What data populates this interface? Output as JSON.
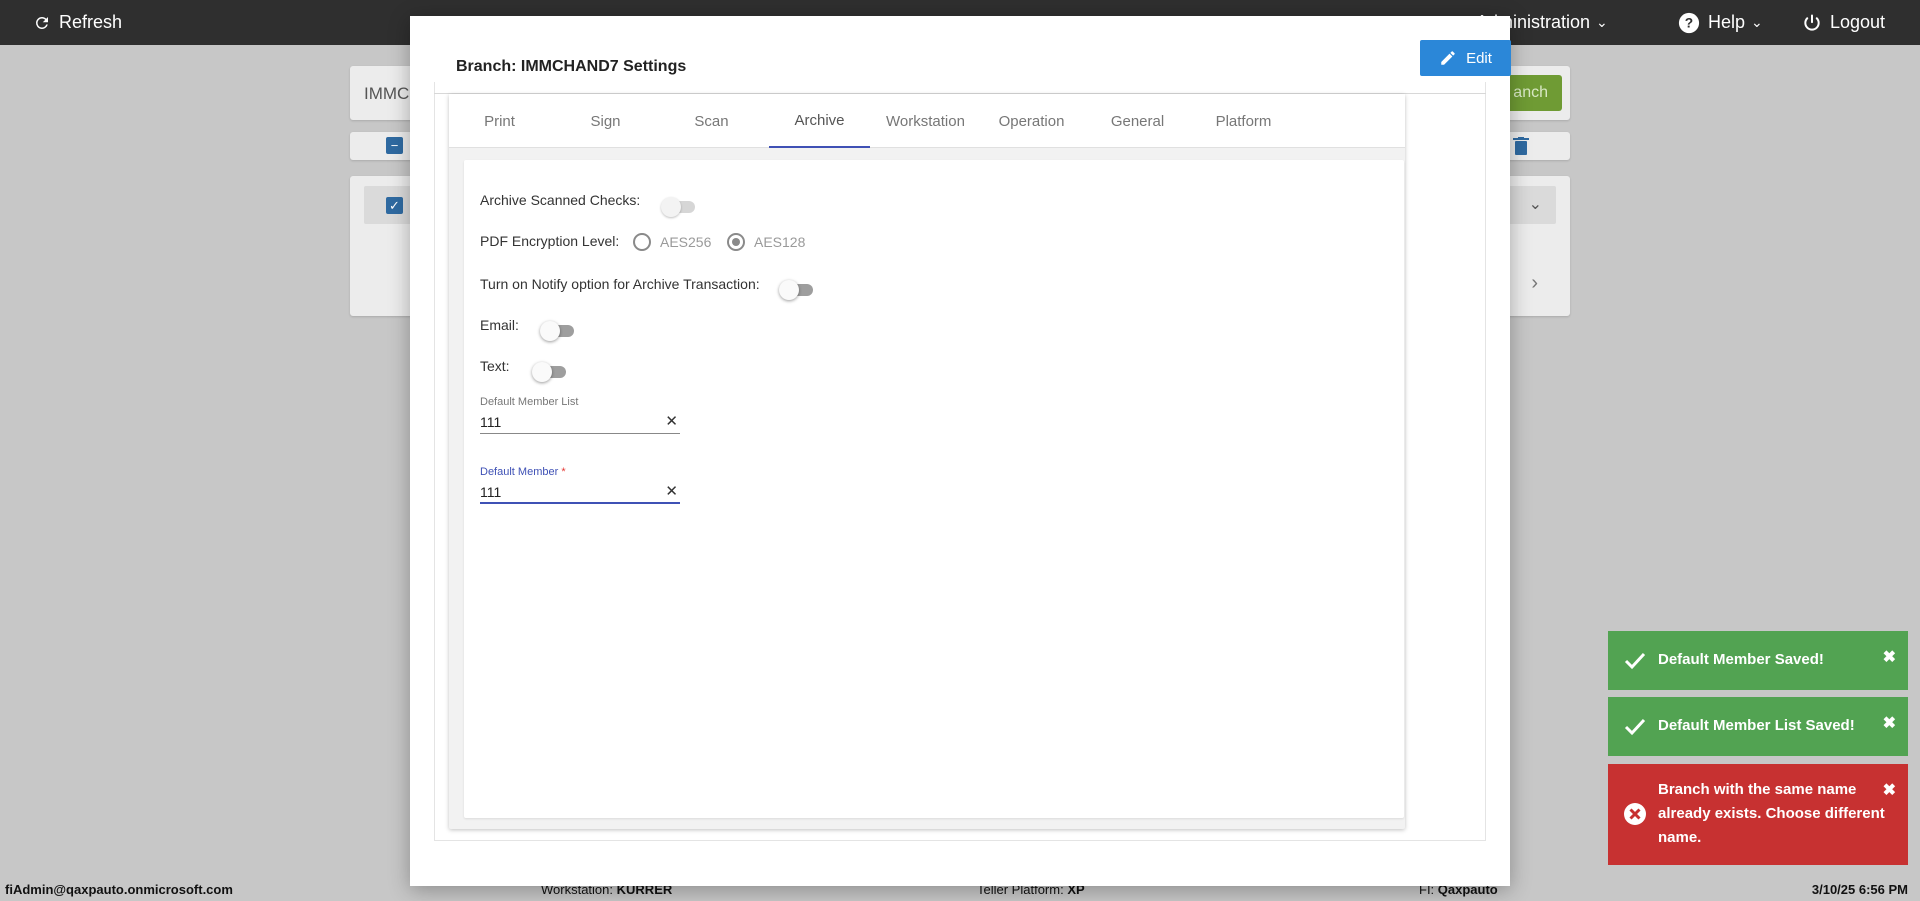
{
  "topbar": {
    "refresh_label": "Refresh",
    "administration_label": "Administration",
    "help_label": "Help",
    "logout_label": "Logout"
  },
  "background": {
    "search_value": "IMMCH",
    "add_button_label": "anch"
  },
  "modal": {
    "title": "Branch: IMMCHAND7 Settings",
    "edit_label": "Edit",
    "tabs": [
      {
        "label": "Print"
      },
      {
        "label": "Sign"
      },
      {
        "label": "Scan"
      },
      {
        "label": "Archive",
        "active": true
      },
      {
        "label": "Workstation"
      },
      {
        "label": "Operation"
      },
      {
        "label": "General"
      },
      {
        "label": "Platform"
      }
    ],
    "archive": {
      "archive_scanned_checks_label": "Archive Scanned Checks:",
      "pdf_encryption_label": "PDF Encryption Level:",
      "encryption_options": [
        "AES256",
        "AES128"
      ],
      "encryption_selected": "AES128",
      "notify_label": "Turn on Notify option for Archive Transaction:",
      "email_label": "Email:",
      "text_label": "Text:",
      "default_member_list_label": "Default Member List",
      "default_member_list_value": "111",
      "default_member_label": "Default Member",
      "default_member_required": "*",
      "default_member_value": "111"
    }
  },
  "toasts": [
    {
      "type": "success",
      "message": "Default Member Saved!"
    },
    {
      "type": "success",
      "message": "Default Member List Saved!"
    },
    {
      "type": "error",
      "message": "Branch with the same name already exists. Choose different name."
    }
  ],
  "statusbar": {
    "user": "fiAdmin@qaxpauto.onmicrosoft.com",
    "workstation_label": "Workstation:",
    "workstation_value": "KURRER",
    "teller_platform_label": "Teller Platform:",
    "teller_platform_value": "XP",
    "fi_label": "FI:",
    "fi_value": "Qaxpauto",
    "datetime": "3/10/25 6:56 PM"
  },
  "colors": {
    "primary_blue": "#2b87d8",
    "tab_indicator": "#3f51b5",
    "success_green": "#52a352",
    "error_red": "#c73131",
    "topbar": "#2f2f2f"
  }
}
